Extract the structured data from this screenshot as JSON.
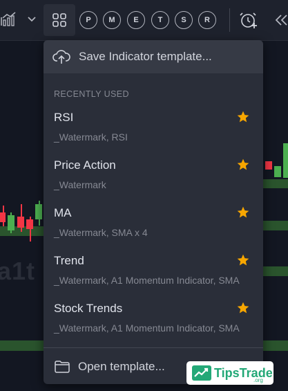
{
  "toolbar": {
    "icons": [
      "chart-style-icon",
      "chevron-down-icon",
      "indicator-templates-icon",
      "alert-clock-icon",
      "rewind-icon"
    ],
    "letter_buttons": [
      "P",
      "M",
      "E",
      "T",
      "S",
      "R"
    ]
  },
  "chart": {
    "watermark_text": "a1t",
    "colors": {
      "bull": "#4caf50",
      "bear": "#f23645",
      "band": "#2e5b2f"
    }
  },
  "menu": {
    "save_label": "Save Indicator template...",
    "section_title": "RECENTLY USED",
    "items": [
      {
        "name": "RSI",
        "description": "_Watermark, RSI",
        "favorite": true
      },
      {
        "name": "Price Action",
        "description": "_Watermark",
        "favorite": true
      },
      {
        "name": "MA",
        "description": "_Watermark, SMA x 4",
        "favorite": true
      },
      {
        "name": "Trend",
        "description": "_Watermark, A1 Momentum Indicator, SMA",
        "favorite": true
      },
      {
        "name": "Stock Trends",
        "description": "_Watermark, A1 Momentum Indicator, SMA",
        "favorite": true
      }
    ],
    "open_label": "Open template...",
    "star_color": "#f7a600"
  },
  "logo": {
    "brand": "TipsTrade",
    "suffix": ".org",
    "color": "#23a877"
  }
}
